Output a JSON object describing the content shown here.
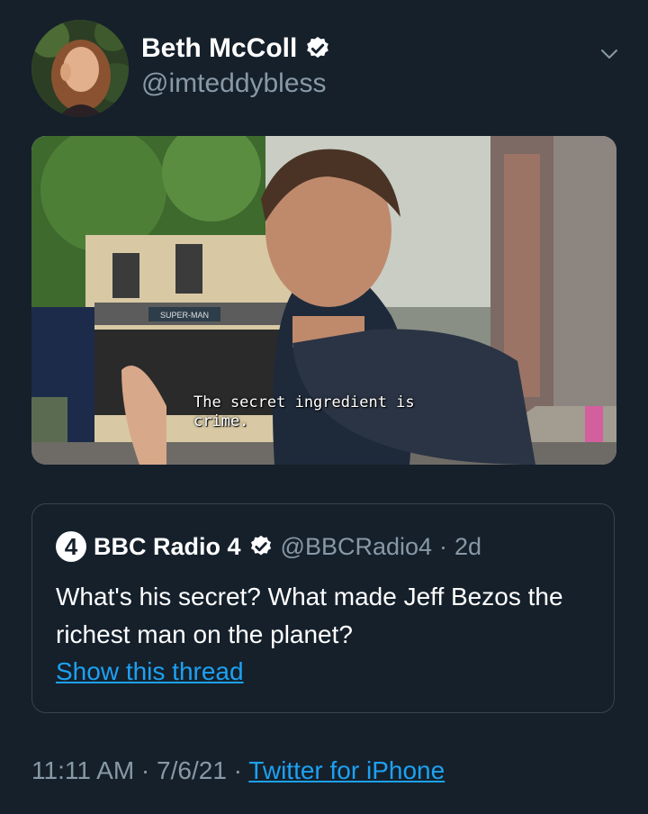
{
  "author": {
    "display_name": "Beth McColl",
    "handle": "@imteddybless",
    "verified": true
  },
  "media": {
    "subtitle": "The secret ingredient is\ncrime.",
    "shop_sign": "SUPER-MAN"
  },
  "quoted_tweet": {
    "logo_text": "4",
    "display_name": "BBC Radio 4",
    "handle": "@BBCRadio4",
    "separator": "·",
    "age": "2d",
    "text": "What's his secret? What made Jeff Bezos the richest man on the planet?",
    "thread_link": "Show this thread"
  },
  "meta": {
    "time": "11:11 AM",
    "sep1": " · ",
    "date": "7/6/21",
    "sep2": " · ",
    "source": "Twitter for iPhone"
  },
  "colors": {
    "background": "#15202b",
    "secondary_text": "#8899a6",
    "link": "#1da1f2",
    "border": "#38444d"
  },
  "icons": [
    "verified-badge-icon",
    "chevron-down-icon"
  ]
}
